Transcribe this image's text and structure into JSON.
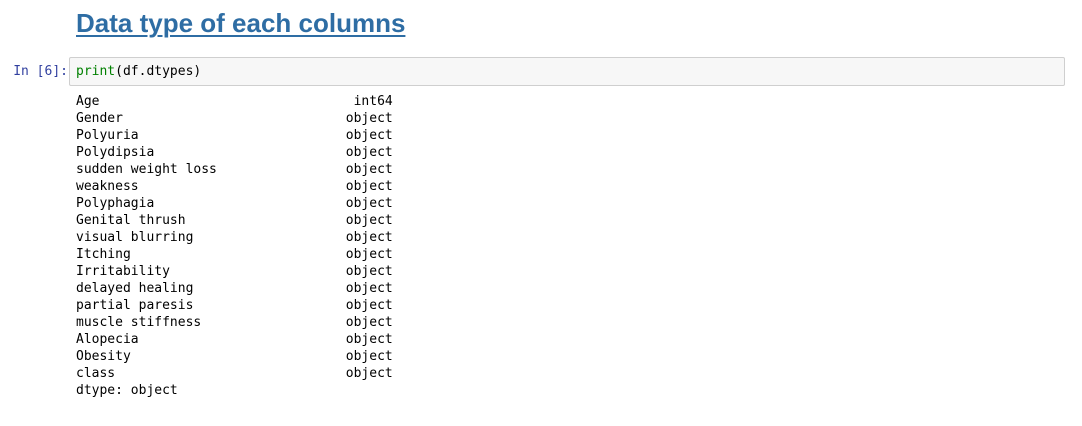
{
  "heading": "Data type of each columns",
  "cell": {
    "prompt": "In [6]:",
    "code": {
      "fn": "print",
      "open": "(",
      "arg": "df.dtypes",
      "close": ")"
    }
  },
  "output": {
    "rows": [
      {
        "name": "Age",
        "type": "int64"
      },
      {
        "name": "Gender",
        "type": "object"
      },
      {
        "name": "Polyuria",
        "type": "object"
      },
      {
        "name": "Polydipsia",
        "type": "object"
      },
      {
        "name": "sudden weight loss",
        "type": "object"
      },
      {
        "name": "weakness",
        "type": "object"
      },
      {
        "name": "Polyphagia",
        "type": "object"
      },
      {
        "name": "Genital thrush",
        "type": "object"
      },
      {
        "name": "visual blurring",
        "type": "object"
      },
      {
        "name": "Itching",
        "type": "object"
      },
      {
        "name": "Irritability",
        "type": "object"
      },
      {
        "name": "delayed healing",
        "type": "object"
      },
      {
        "name": "partial paresis",
        "type": "object"
      },
      {
        "name": "muscle stiffness",
        "type": "object"
      },
      {
        "name": "Alopecia",
        "type": "object"
      },
      {
        "name": "Obesity",
        "type": "object"
      },
      {
        "name": "class",
        "type": "object"
      }
    ],
    "footer": "dtype: object"
  },
  "colors": {
    "heading": "#2e6da4",
    "prompt": "#303f9f",
    "builtin": "#008000",
    "input_bg": "#f7f7f7",
    "input_border": "#cfcfcf"
  }
}
